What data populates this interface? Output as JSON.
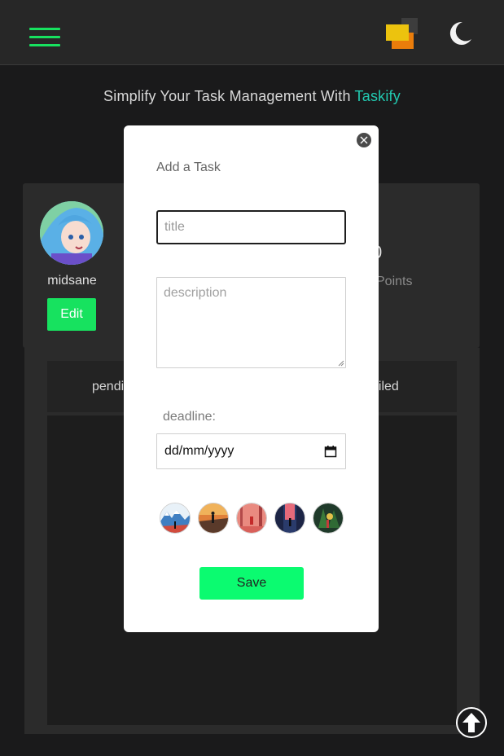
{
  "header": {
    "menu_icon": "hamburger-menu-icon",
    "logo_icon": "stacked-squares-logo",
    "theme_icon": "moon-icon",
    "accent_color": "#17e25f"
  },
  "tagline": {
    "text": "Simplify Your Task Management With ",
    "brand": "Taskify",
    "brand_color": "#22c9b0"
  },
  "profile": {
    "username": "midsane",
    "edit_label": "Edit",
    "count_value": "0",
    "points_label": "Points"
  },
  "tabs": {
    "pending_label": "pendi",
    "failed_label": "ailed"
  },
  "modal": {
    "title": "Add a Task",
    "title_placeholder": "title",
    "description_placeholder": "description",
    "deadline_label": "deadline:",
    "date_value": "dd/mm/yyyy",
    "save_label": "Save",
    "save_color": "#0bfb70",
    "thumbnails": [
      "mountain-snow-thumb",
      "sunset-figure-thumb",
      "red-forest-thumb",
      "city-alley-thumb",
      "green-forest-thumb"
    ]
  },
  "scroll_top_icon": "arrow-up-icon"
}
